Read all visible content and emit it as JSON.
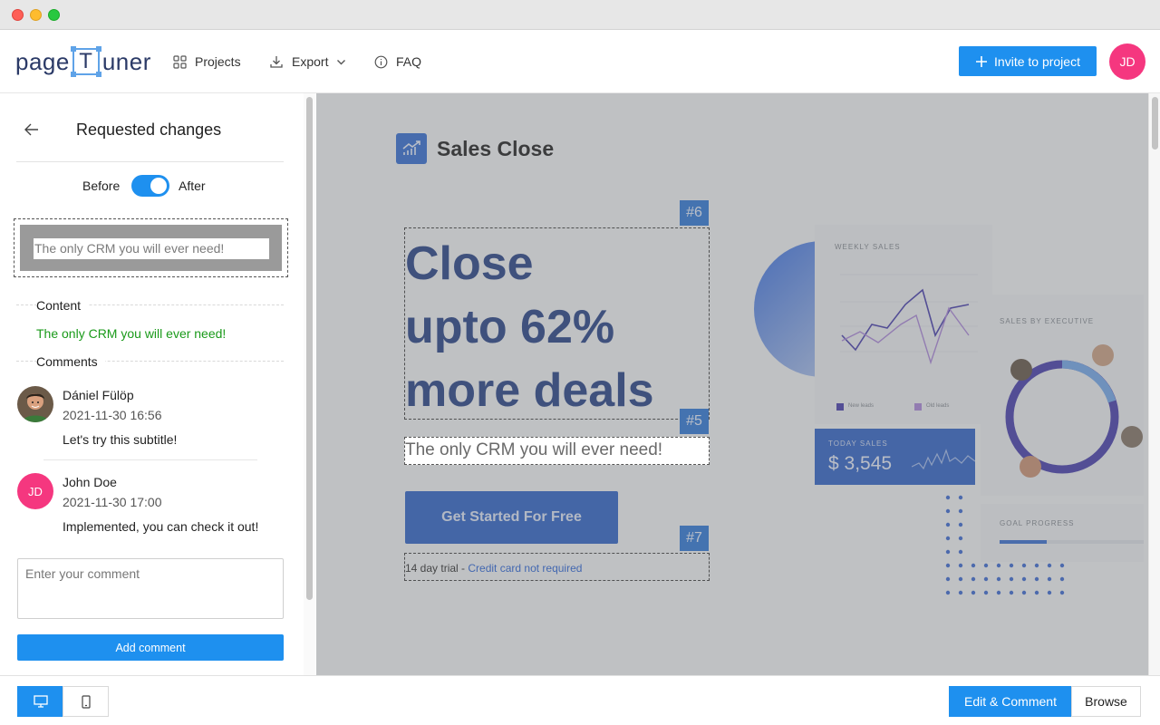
{
  "header": {
    "logo_left": "page",
    "logo_box": "T",
    "logo_right": "uner",
    "nav": [
      {
        "label": "Projects",
        "icon": "grid-icon"
      },
      {
        "label": "Export",
        "icon": "download-icon"
      },
      {
        "label": "FAQ",
        "icon": "info-icon"
      }
    ],
    "invite_label": "Invite to project",
    "user_initials": "JD"
  },
  "sidebar": {
    "title": "Requested changes",
    "toggle_before": "Before",
    "toggle_after": "After",
    "toggle_on": true,
    "preview_text": "The only CRM you will ever need!",
    "content_label": "Content",
    "content_text": "The only CRM you will ever need!",
    "comments_label": "Comments",
    "comments": [
      {
        "name": "Dániel Fülöp",
        "date": "2021-11-30 16:56",
        "text": "Let's try this subtitle!"
      },
      {
        "name": "John Doe",
        "initials": "JD",
        "date": "2021-11-30 17:00",
        "text": "Implemented, you can check it out!"
      }
    ],
    "comment_placeholder": "Enter your comment",
    "add_comment_label": "Add comment"
  },
  "preview": {
    "brand": "Sales Close",
    "headline": [
      "Close",
      "upto 62%",
      "more deals"
    ],
    "subtitle": "The only CRM you will ever need!",
    "cta": "Get Started For Free",
    "trial_prefix": "14 day trial - ",
    "trial_link": "Credit card not required",
    "tags": [
      "#6",
      "#5",
      "#7"
    ],
    "dashboard": {
      "weekly_sales": "WEEKLY SALES",
      "sales_by_executive": "SALES BY EXECUTIVE",
      "legend_new": "New leads",
      "legend_old": "Old leads",
      "today_sales_label": "TODAY SALES",
      "today_sales_value": "$ 3,545",
      "goal_progress": "GOAL PROGRESS",
      "goal_progress_value": 0.33
    }
  },
  "bottom": {
    "edit_comment_label": "Edit & Comment",
    "browse_label": "Browse"
  },
  "colors": {
    "accent": "#1e90ef",
    "avatar": "#f5377f",
    "headline": "#17347f",
    "content_green": "#1a9a1a"
  }
}
